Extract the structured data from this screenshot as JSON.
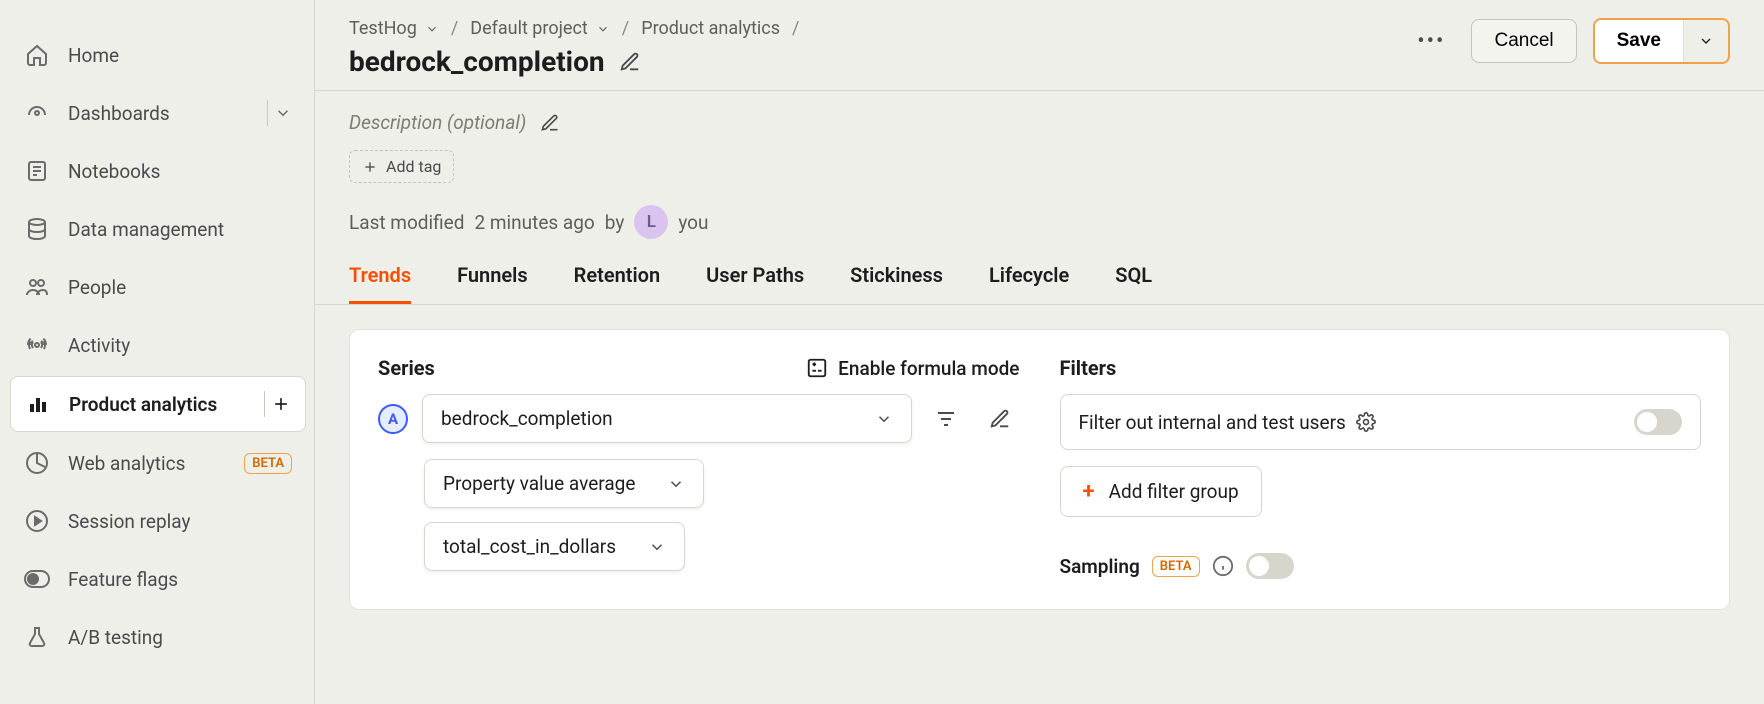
{
  "sidebar": {
    "items": [
      {
        "label": "Home"
      },
      {
        "label": "Dashboards"
      },
      {
        "label": "Notebooks"
      },
      {
        "label": "Data management"
      },
      {
        "label": "People"
      },
      {
        "label": "Activity"
      },
      {
        "label": "Product analytics"
      },
      {
        "label": "Web analytics",
        "badge": "BETA"
      },
      {
        "label": "Session replay"
      },
      {
        "label": "Feature flags"
      },
      {
        "label": "A/B testing"
      }
    ]
  },
  "breadcrumbs": {
    "org": "TestHog",
    "project": "Default project",
    "section": "Product analytics"
  },
  "header": {
    "title": "bedrock_completion",
    "cancel": "Cancel",
    "save": "Save"
  },
  "meta": {
    "description_placeholder": "Description (optional)",
    "add_tag": "Add tag",
    "last_modified_prefix": "Last modified",
    "last_modified_time": "2 minutes ago",
    "last_modified_by_word": "by",
    "avatar_letter": "L",
    "last_modified_who": "you"
  },
  "tabs": [
    "Trends",
    "Funnels",
    "Retention",
    "User Paths",
    "Stickiness",
    "Lifecycle",
    "SQL"
  ],
  "active_tab": "Trends",
  "series": {
    "heading": "Series",
    "formula_link": "Enable formula mode",
    "badge": "A",
    "event": "bedrock_completion",
    "aggregation": "Property value average",
    "property": "total_cost_in_dollars"
  },
  "filters": {
    "heading": "Filters",
    "filter_out_label": "Filter out internal and test users",
    "add_filter": "Add filter group",
    "sampling_label": "Sampling",
    "sampling_badge": "BETA"
  }
}
